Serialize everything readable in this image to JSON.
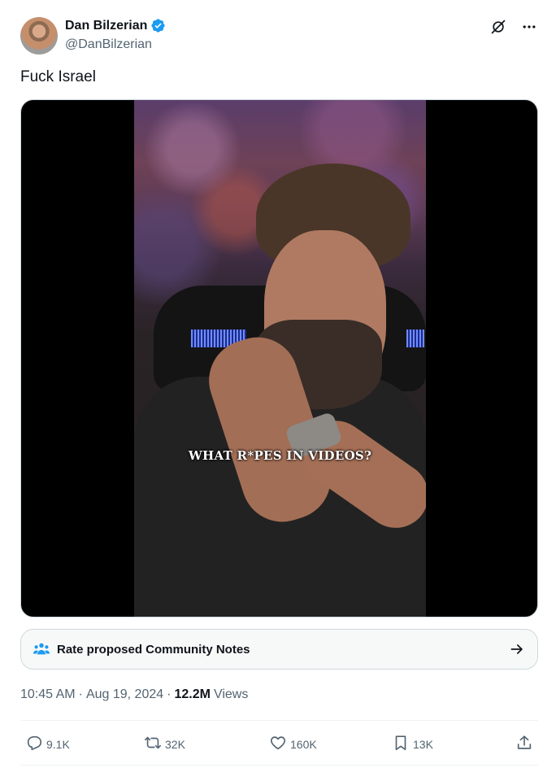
{
  "author": {
    "display_name": "Dan Bilzerian",
    "handle": "@DanBilzerian",
    "verified": true
  },
  "tweet": {
    "text": "Fuck Israel"
  },
  "media": {
    "caption": "WHAT R*PES IN VIDEOS?"
  },
  "community_notes": {
    "label": "Rate proposed Community Notes"
  },
  "meta": {
    "time": "10:45 AM",
    "separator": "·",
    "date": "Aug 19, 2024",
    "separator2": "·",
    "views_count": "12.2M",
    "views_label": "Views"
  },
  "actions": {
    "replies": "9.1K",
    "reposts": "32K",
    "likes": "160K",
    "bookmarks": "13K"
  },
  "colors": {
    "accent": "#1d9bf0",
    "secondary_text": "#536471",
    "primary_text": "#0f1419"
  },
  "icons": [
    "verified-badge-icon",
    "grok-icon",
    "more-icon",
    "community-notes-icon",
    "arrow-right-icon",
    "reply-icon",
    "repost-icon",
    "like-icon",
    "bookmark-icon",
    "share-icon"
  ]
}
